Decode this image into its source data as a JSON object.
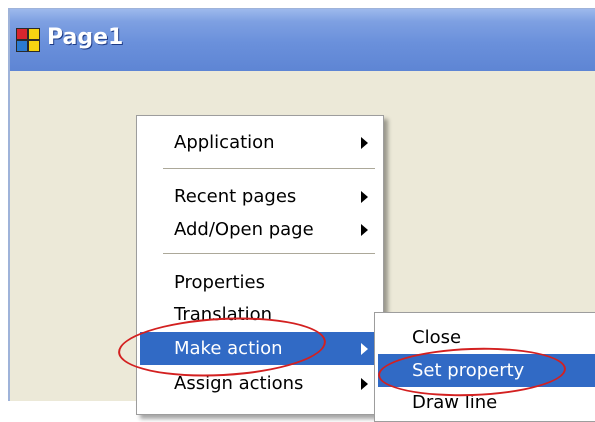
{
  "window": {
    "title": "Page1",
    "icon": "app-window-icon"
  },
  "context_menu": {
    "items": [
      {
        "label": "Application",
        "has_submenu": true
      },
      {
        "label": "Recent pages",
        "has_submenu": true
      },
      {
        "label": "Add/Open page",
        "has_submenu": true
      },
      {
        "label": "Properties",
        "has_submenu": false
      },
      {
        "label": "Translation",
        "has_submenu": false
      },
      {
        "label": "Make action",
        "has_submenu": true,
        "highlighted": true
      },
      {
        "label": "Assign actions",
        "has_submenu": true
      }
    ]
  },
  "submenu": {
    "items": [
      {
        "label": "Close"
      },
      {
        "label": "Set property",
        "highlighted": true
      },
      {
        "label": "Draw line"
      }
    ]
  },
  "colors": {
    "highlight": "#316ac5",
    "annotation": "#d32020",
    "titlebar": "#6a90db",
    "background": "#ece9d8"
  }
}
